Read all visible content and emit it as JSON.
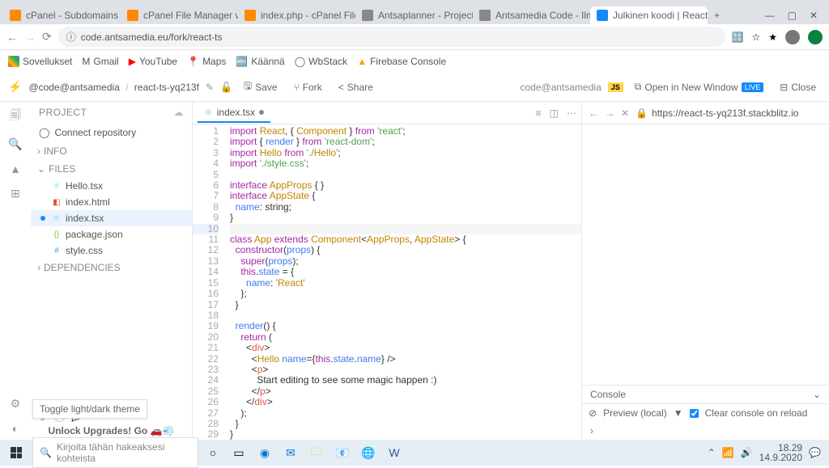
{
  "browser": {
    "tabs": [
      {
        "label": "cPanel - Subdomains",
        "icon": "orange"
      },
      {
        "label": "cPanel File Manager v3",
        "icon": "orange"
      },
      {
        "label": "index.php - cPanel File",
        "icon": "orange"
      },
      {
        "label": "Antsaplanner - Project",
        "icon": "gray"
      },
      {
        "label": "Antsamedia Code - Ilm",
        "icon": "gray"
      },
      {
        "label": "Julkinen koodi | React |",
        "icon": "blue"
      }
    ],
    "url": "code.antsamedia.eu/fork/react-ts",
    "bookmarks": [
      "Sovellukset",
      "Gmail",
      "YouTube",
      "Maps",
      "Käännä",
      "WbStack",
      "Firebase Console"
    ]
  },
  "topbar": {
    "user": "@code@antsamedia",
    "project": "react-ts-yq213f",
    "save": "Save",
    "fork": "Fork",
    "share": "Share",
    "right_user": "code@antsamedia",
    "open_new": "Open in New Window",
    "live": "LIVE",
    "close": "Close"
  },
  "sidebar": {
    "title": "PROJECT",
    "connect": "Connect repository",
    "info": "INFO",
    "files": "FILES",
    "deps": "DEPENDENCIES",
    "flist": [
      {
        "name": "Hello.tsx",
        "icon": "⚛",
        "color": "#61dafb"
      },
      {
        "name": "index.html",
        "icon": "◧",
        "color": "#e44d26"
      },
      {
        "name": "index.tsx",
        "icon": "⚛",
        "color": "#61dafb",
        "active": true
      },
      {
        "name": "package.json",
        "icon": "{}",
        "color": "#8bc34a"
      },
      {
        "name": "style.css",
        "icon": "#",
        "color": "#42a5f5"
      }
    ],
    "upgrade": "Unlock Upgrades! Go 🚗💨"
  },
  "editor": {
    "tab": "index.tsx",
    "lines": [
      "import React, { Component } from 'react';",
      "import { render } from 'react-dom';",
      "import Hello from './Hello';",
      "import './style.css';",
      "",
      "interface AppProps { }",
      "interface AppState {",
      "  name: string;",
      "}",
      "",
      "class App extends Component<AppProps, AppState> {",
      "  constructor(props) {",
      "    super(props);",
      "    this.state = {",
      "      name: 'React'",
      "    };",
      "  }",
      "",
      "  render() {",
      "    return (",
      "      <div>",
      "        <Hello name={this.state.name} />",
      "        <p>",
      "          Start editing to see some magic happen :)",
      "        </p>",
      "      </div>",
      "    );",
      "  }",
      "}",
      ""
    ]
  },
  "preview": {
    "url": "https://react-ts-yq213f.stackblitz.io",
    "console": "Console",
    "preview_lbl": "Preview (local)",
    "clear": "Clear console on reload"
  },
  "tooltip": "Toggle light/dark theme",
  "taskbar": {
    "search": "Kirjoita tähän hakeaksesi kohteista",
    "time": "18.29",
    "date": "14.9.2020"
  }
}
